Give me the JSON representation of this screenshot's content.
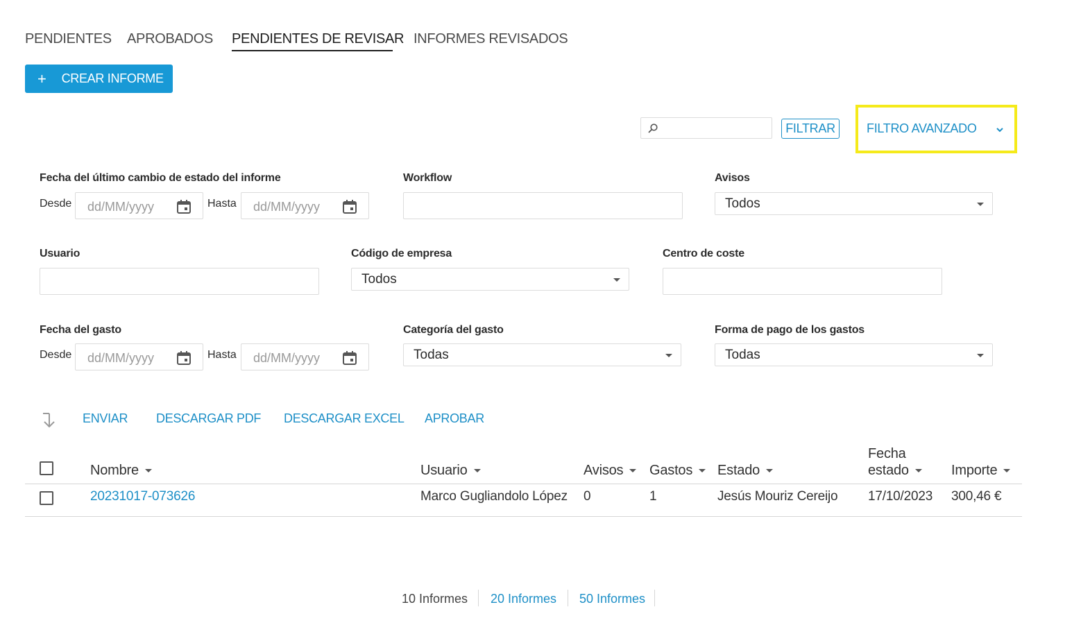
{
  "tabs": [
    {
      "label": "PENDIENTES"
    },
    {
      "label": "APROBADOS"
    },
    {
      "label": "PENDIENTES DE REVISAR",
      "active": true
    },
    {
      "label": "INFORMES REVISADOS"
    }
  ],
  "create_button": {
    "icon": "plus-icon",
    "label": "CREAR INFORME"
  },
  "search": {
    "placeholder": "",
    "value": "",
    "icon": "search-icon"
  },
  "filter_button": "FILTRAR",
  "advanced_filter": {
    "label": "FILTRO AVANZADO",
    "icon": "chevron-down-icon",
    "highlight_color": "#f5ea1a"
  },
  "filters": {
    "report_date": {
      "label": "Fecha del último cambio de estado del informe",
      "from_label": "Desde",
      "to_label": "Hasta",
      "placeholder": "dd/MM/yyyy"
    },
    "workflow": {
      "label": "Workflow",
      "value": ""
    },
    "avisos": {
      "label": "Avisos",
      "value": "Todos"
    },
    "usuario": {
      "label": "Usuario",
      "value": ""
    },
    "codigo_empresa": {
      "label": "Código de empresa",
      "value": "Todos"
    },
    "centro_coste": {
      "label": "Centro de coste",
      "value": ""
    },
    "expense_date": {
      "label": "Fecha del gasto",
      "from_label": "Desde",
      "to_label": "Hasta",
      "placeholder": "dd/MM/yyyy"
    },
    "categoria": {
      "label": "Categoría del gasto",
      "value": "Todas"
    },
    "forma_pago": {
      "label": "Forma de pago de los gastos",
      "value": "Todas"
    }
  },
  "actions": [
    "ENVIAR",
    "DESCARGAR PDF",
    "DESCARGAR EXCEL",
    "APROBAR"
  ],
  "table": {
    "columns": [
      "Nombre",
      "Usuario",
      "Avisos",
      "Gastos",
      "Estado",
      "Fecha estado",
      "Importe"
    ],
    "columns_wrapped": {
      "fecha_line1": "Fecha",
      "fecha_line2": "estado"
    },
    "rows": [
      {
        "nombre": "20231017-073626",
        "usuario": "Marco Gugliandolo López",
        "avisos": "0",
        "gastos": "1",
        "estado": "Jesús Mouriz Cereijo",
        "fecha": "17/10/2023",
        "importe": "300,46 €"
      }
    ]
  },
  "pagination": [
    "10 Informes",
    "20 Informes",
    "50 Informes"
  ],
  "colors": {
    "accent": "#1899d6",
    "link": "#1d8fc7"
  }
}
